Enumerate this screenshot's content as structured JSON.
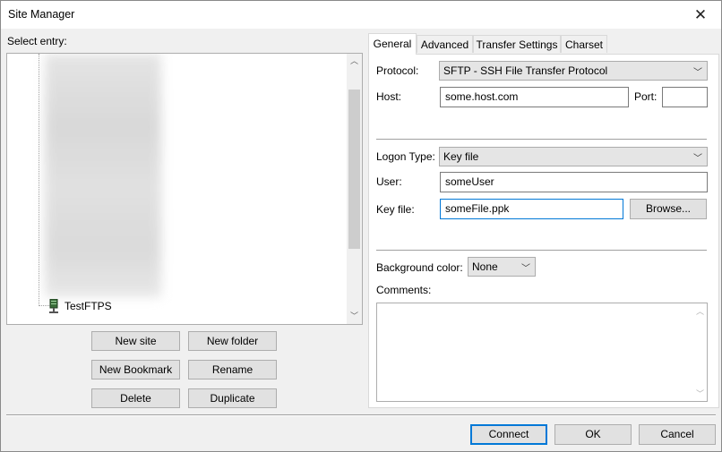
{
  "window": {
    "title": "Site Manager",
    "close_glyph": "✕"
  },
  "left": {
    "select_entry_label": "Select entry:",
    "tree_items": [
      {
        "label": "TestFTPS",
        "icon": "server-icon"
      }
    ],
    "buttons": {
      "new_site": "New site",
      "new_folder": "New folder",
      "new_bookmark": "New Bookmark",
      "rename": "Rename",
      "delete": "Delete",
      "duplicate": "Duplicate"
    }
  },
  "tabs": [
    "General",
    "Advanced",
    "Transfer Settings",
    "Charset"
  ],
  "general": {
    "protocol_label": "Protocol:",
    "protocol_value": "SFTP - SSH File Transfer Protocol",
    "host_label": "Host:",
    "host_value": "some.host.com",
    "port_label": "Port:",
    "port_value": "",
    "logon_type_label": "Logon Type:",
    "logon_type_value": "Key file",
    "user_label": "User:",
    "user_value": "someUser",
    "key_file_label": "Key file:",
    "key_file_value": "someFile.ppk",
    "browse_label": "Browse...",
    "background_color_label": "Background color:",
    "background_color_value": "None",
    "comments_label": "Comments:",
    "comments_value": ""
  },
  "footer": {
    "connect": "Connect",
    "ok": "OK",
    "cancel": "Cancel"
  },
  "colors": {
    "focus_accent": "#0078d7",
    "dialog_bg": "#f0f0f0"
  }
}
